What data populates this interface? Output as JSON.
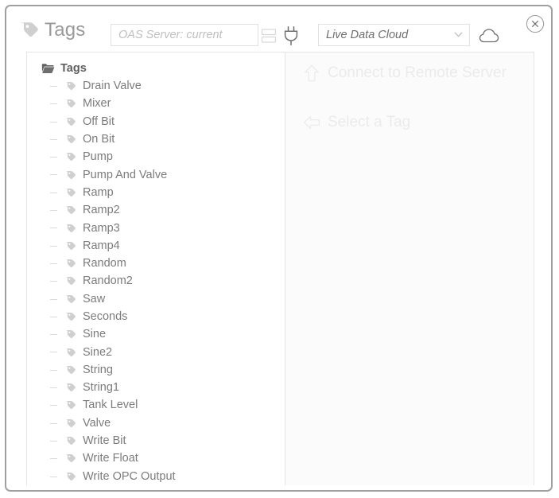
{
  "window": {
    "title": "Tags",
    "title_icon": "tag-icon",
    "close_icon": "close-circle-icon"
  },
  "header": {
    "server_input": {
      "value": "",
      "placeholder": "OAS Server: current"
    },
    "server_icon": "server-stack-icon",
    "plug_icon": "plug-icon",
    "source_select": {
      "selected": "Live Data Cloud",
      "options": [
        "Live Data Cloud"
      ]
    },
    "cloud_icon": "cloud-icon",
    "chevron_icon": "chevron-down-icon"
  },
  "tree": {
    "root_label": "Tags",
    "root_icon": "folder-icon",
    "items": [
      {
        "label": "Drain Valve"
      },
      {
        "label": "Mixer"
      },
      {
        "label": "Off Bit"
      },
      {
        "label": "On Bit"
      },
      {
        "label": "Pump"
      },
      {
        "label": "Pump And Valve"
      },
      {
        "label": "Ramp"
      },
      {
        "label": "Ramp2"
      },
      {
        "label": "Ramp3"
      },
      {
        "label": "Ramp4"
      },
      {
        "label": "Random"
      },
      {
        "label": "Random2"
      },
      {
        "label": "Saw"
      },
      {
        "label": "Seconds"
      },
      {
        "label": "Sine"
      },
      {
        "label": "Sine2"
      },
      {
        "label": "String"
      },
      {
        "label": "String1"
      },
      {
        "label": "Tank Level"
      },
      {
        "label": "Valve"
      },
      {
        "label": "Write Bit"
      },
      {
        "label": "Write Float"
      },
      {
        "label": "Write OPC Output"
      }
    ]
  },
  "detail": {
    "connect_hint": "Connect to Remote Server",
    "connect_hint_icon": "arrow-up-icon",
    "select_hint": "Select a Tag",
    "select_hint_icon": "arrow-left-icon"
  },
  "colors": {
    "window_border": "#a0a0a0",
    "title_text": "#9a9a9a",
    "tree_text": "#7c7c7c",
    "hint_text": "#ebebeb",
    "panel_bg": "#fbfbfb"
  }
}
